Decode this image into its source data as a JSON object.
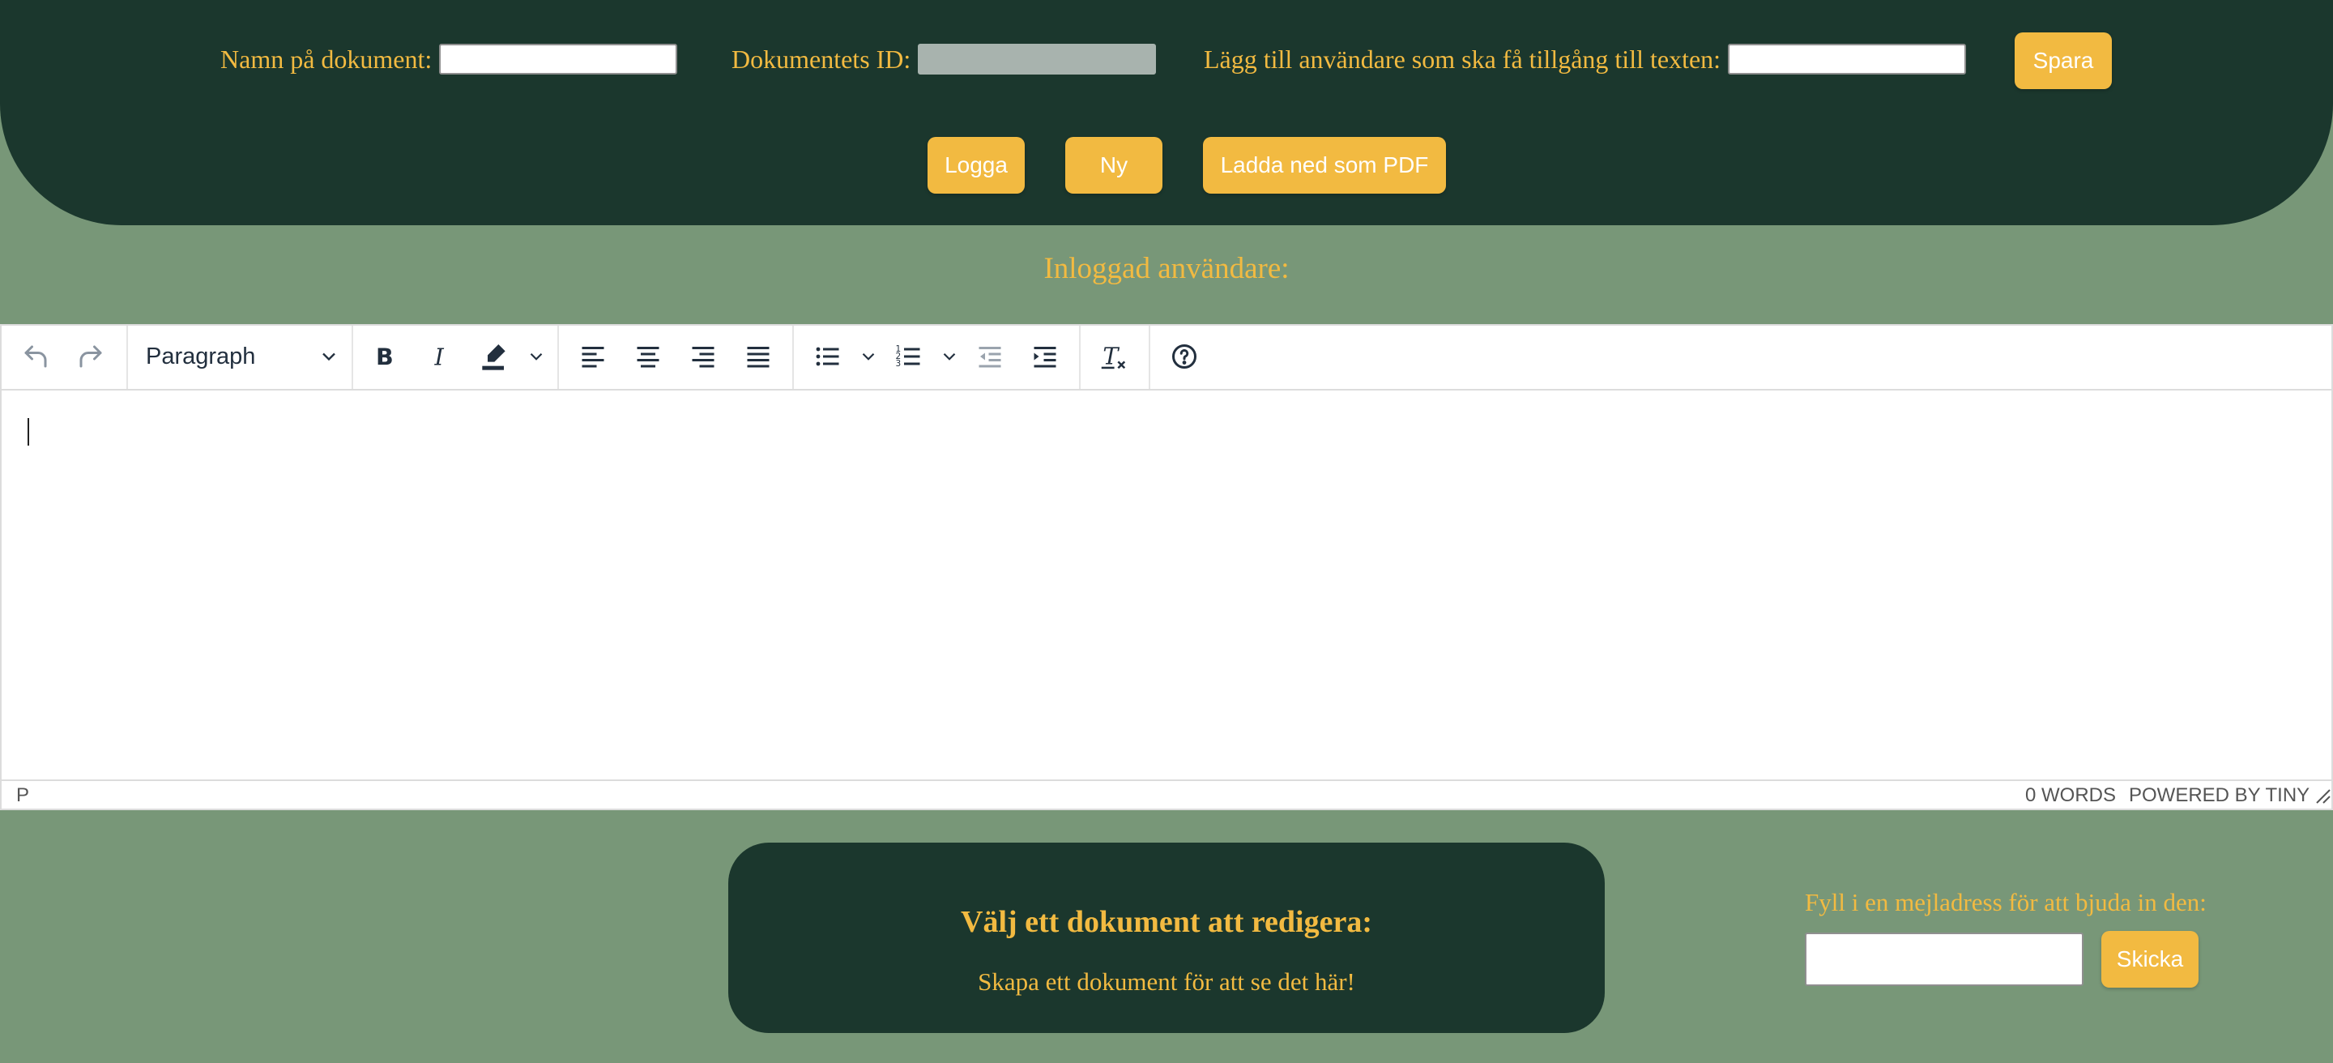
{
  "header": {
    "doc_name_label": "Namn på dokument:",
    "doc_name_value": "",
    "doc_id_label": "Dokumentets ID:",
    "doc_id_value": "",
    "add_user_label": "Lägg till användare som ska få tillgång till texten:",
    "add_user_value": "",
    "save_label": "Spara",
    "log_label": "Logga",
    "new_label": "Ny",
    "pdf_label": "Ladda ned som PDF"
  },
  "logged_in_label": "Inloggad användare:",
  "editor": {
    "block_format": "Paragraph",
    "status_path": "P",
    "word_count": "0 WORDS",
    "powered_by": "POWERED BY TINY",
    "icons": [
      "undo-icon",
      "redo-icon",
      "chevron-down-icon",
      "bold-icon",
      "italic-icon",
      "highlight-icon",
      "align-left-icon",
      "align-center-icon",
      "align-right-icon",
      "justify-icon",
      "bullet-list-icon",
      "numbered-list-icon",
      "outdent-icon",
      "indent-icon",
      "clear-format-icon",
      "help-icon",
      "resize-handle-icon"
    ]
  },
  "documents": {
    "title": "Välj ett dokument att redigera:",
    "empty_text": "Skapa ett dokument för att se det här!"
  },
  "invite": {
    "label": "Fyll i en mejladress för att bjuda in den:",
    "email_value": "",
    "send_label": "Skicka"
  },
  "colors": {
    "accent": "#f2ba41",
    "header_bg": "#1b372d",
    "page_bg": "#789778"
  }
}
